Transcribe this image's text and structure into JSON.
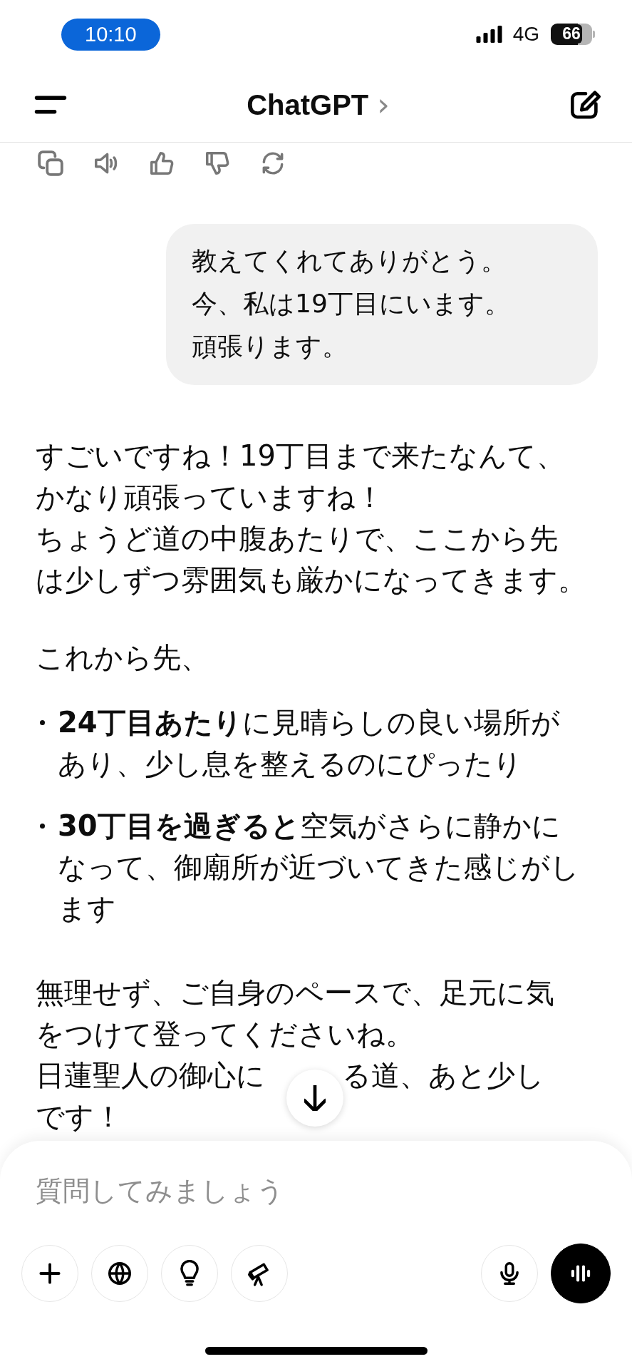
{
  "status_bar": {
    "time": "10:10",
    "network": "4G",
    "battery": "66"
  },
  "header": {
    "title": "ChatGPT",
    "chevron": "›"
  },
  "messages": [
    {
      "kind": "actions"
    },
    {
      "kind": "user",
      "lines": [
        "教えてくれてありがとう。",
        "今、私は19丁目にいます。",
        "頑張ります。"
      ]
    },
    {
      "kind": "paragraph",
      "lines": [
        "すごいですね！19丁目まで来たなんて、",
        "かなり頑張っていますね！",
        "ちょうど道の中腹あたりで、ここから先",
        "は少しずつ雰囲気も厳かになってきます。"
      ]
    },
    {
      "kind": "paragraph",
      "lines": [
        "これから先、"
      ]
    },
    {
      "kind": "bullets",
      "items": [
        [
          "**24丁目あたり**に見晴らしの良い場所が",
          "あり、少し息を整えるのにぴったり"
        ],
        [
          "**30丁目を過ぎると**空気がさらに静かに",
          "なって、御廟所が近づいてきた感じがし",
          "ます"
        ]
      ]
    },
    {
      "kind": "paragraph",
      "lines": [
        "無理せず、ご自身のペースで、足元に気",
        "をつけて登ってくださいね。",
        [
          "日蓮聖人の御心に",
          "る道、あと少し"
        ],
        "です！"
      ]
    }
  ],
  "composer": {
    "placeholder": "質問してみましょう"
  }
}
